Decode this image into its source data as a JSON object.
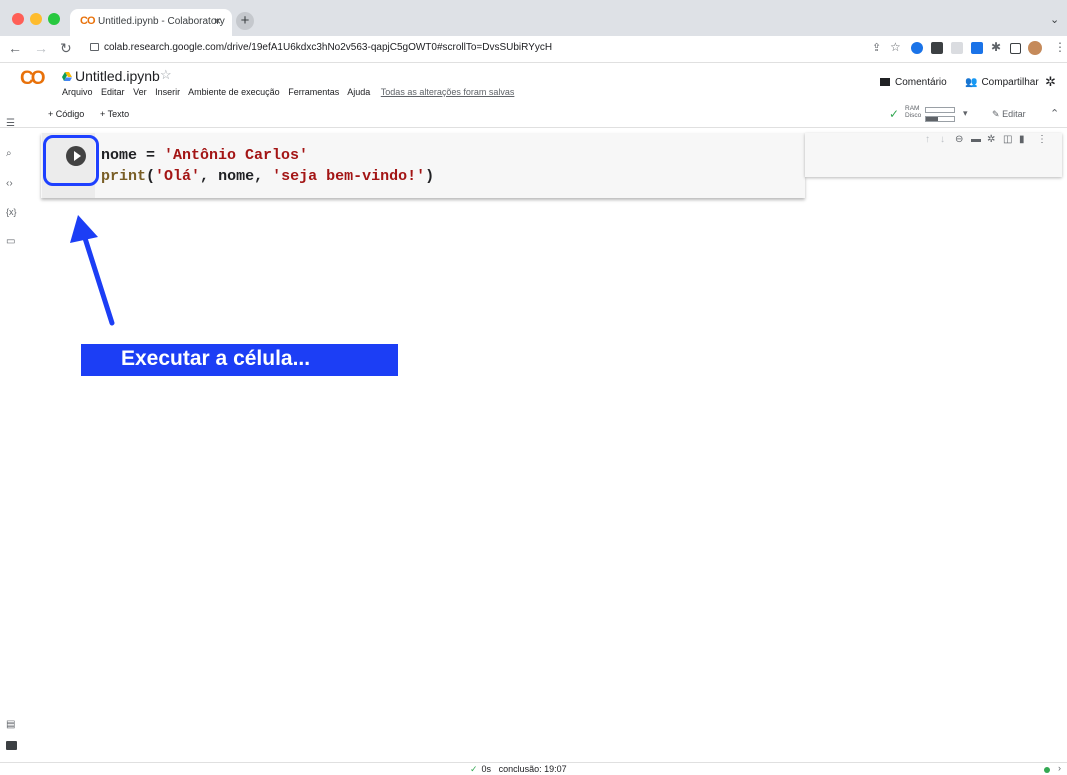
{
  "browser": {
    "tab_title": "Untitled.ipynb - Colaboratory",
    "tab_logo": "CO",
    "tab_close": "×",
    "new_tab": "+",
    "tab_menu": "⌄",
    "url": "colab.research.google.com/drive/19efA1U6kdxc3hNo2v563-qapjC5gOWT0#scrollTo=DvsSUbiRYycH",
    "traffic_light_colors": [
      "#ff5f57",
      "#febc2e",
      "#28c840"
    ]
  },
  "colab": {
    "logo": "CO",
    "notebook_title": "Untitled.ipynb",
    "menus": [
      "Arquivo",
      "Editar",
      "Ver",
      "Inserir",
      "Ambiente de execução",
      "Ferramentas",
      "Ajuda"
    ],
    "save_status": "Todas as alterações foram salvas",
    "comment_label": "Comentário",
    "share_label": "Compartilhar",
    "accent": "#e8710a"
  },
  "toolbar": {
    "add_code": "+ Código",
    "add_text": "+ Texto",
    "ram_label": "RAM",
    "disk_label": "Disco",
    "edit_label": "Editar"
  },
  "cell": {
    "line1": {
      "var": "nome",
      "op": " = ",
      "str": "'Antônio Carlos'"
    },
    "line2": {
      "fn": "print",
      "open": "(",
      "a1": "'Olá'",
      "sep1": ", ",
      "a2": "nome",
      "sep2": ", ",
      "a3": "'seja bem-vindo!'",
      "close": ")"
    }
  },
  "annotation": {
    "text": "Executar a célula...",
    "color": "#1c3ef5"
  },
  "status": {
    "duration": "0s",
    "completion": "conclusão: 19:07"
  }
}
